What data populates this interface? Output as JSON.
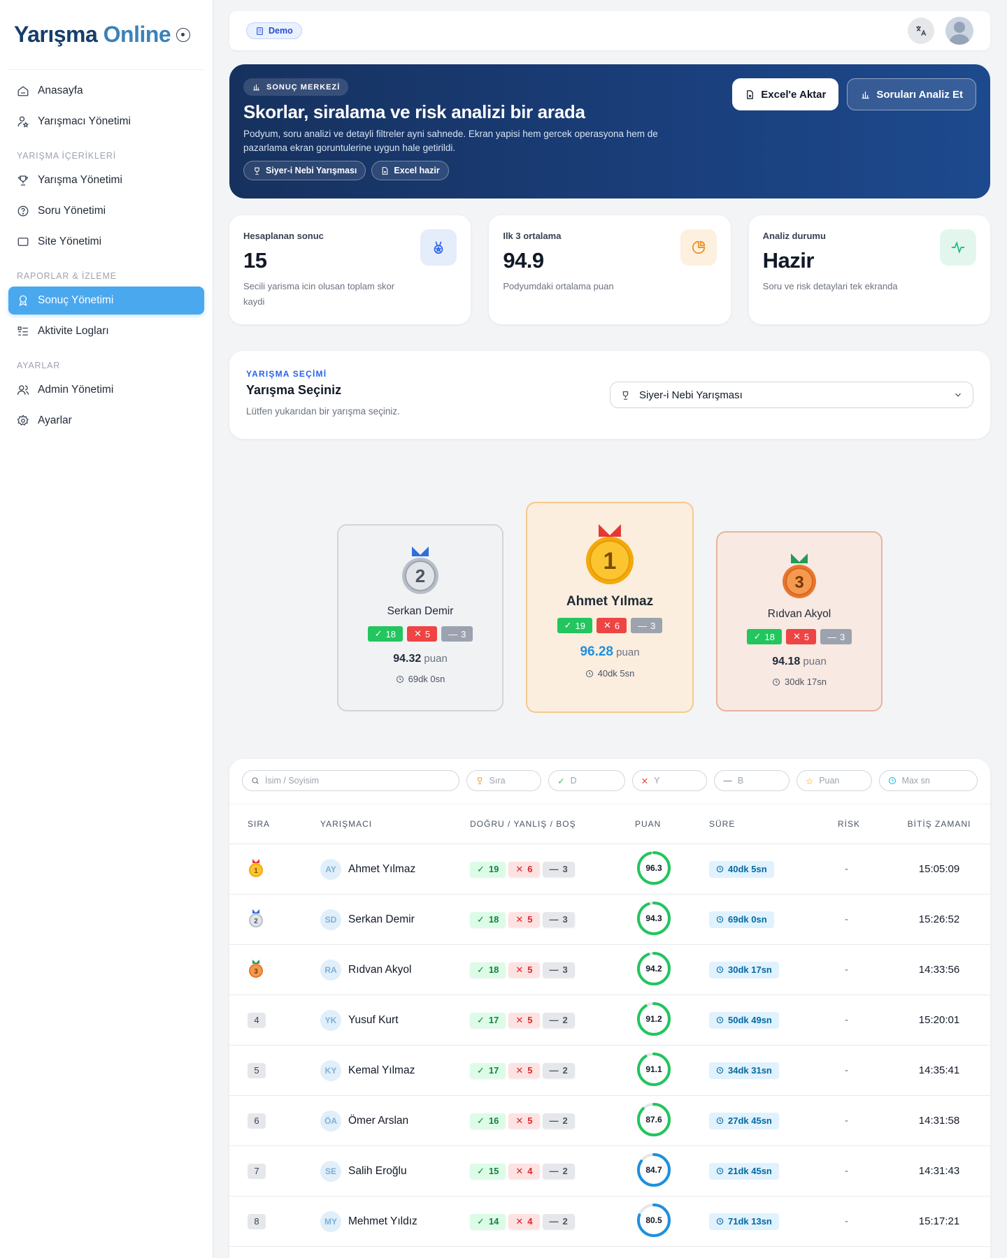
{
  "brand": {
    "part1": "Yarışma",
    "part2": "Online"
  },
  "sidebar": {
    "items_top": [
      {
        "label": "Anasayfa",
        "icon": "home-icon"
      },
      {
        "label": "Yarışmacı Yönetimi",
        "icon": "user-star-icon"
      }
    ],
    "section1": "YARIŞMA İÇERİKLERİ",
    "items_mid": [
      {
        "label": "Yarışma Yönetimi",
        "icon": "trophy-icon"
      },
      {
        "label": "Soru Yönetimi",
        "icon": "help-circle-icon"
      },
      {
        "label": "Site Yönetimi",
        "icon": "window-icon"
      }
    ],
    "section2": "RAPORLAR & İZLEME",
    "items_rep": [
      {
        "label": "Sonuç Yönetimi",
        "icon": "award-icon",
        "active": true
      },
      {
        "label": "Aktivite Logları",
        "icon": "list-icon"
      }
    ],
    "section3": "AYARLAR",
    "items_set": [
      {
        "label": "Admin Yönetimi",
        "icon": "users-icon"
      },
      {
        "label": "Ayarlar",
        "icon": "gear-icon"
      }
    ]
  },
  "topbar": {
    "badge": "Demo"
  },
  "hero": {
    "chip": "SONUÇ MERKEZİ",
    "title": "Skorlar, siralama ve risk analizi bir arada",
    "desc": "Podyum, soru analizi ve detayli filtreler ayni sahnede. Ekran yapisi hem gercek operasyona hem de pazarlama ekran goruntulerine uygun hale getirildi.",
    "tag1": "Siyer-i Nebi Yarışması",
    "tag2": "Excel hazir",
    "btn_excel": "Excel'e Aktar",
    "btn_analyze": "Soruları Analiz Et"
  },
  "stats": [
    {
      "label": "Hesaplanan sonuc",
      "value": "15",
      "sub": "Secili yarisma icin olusan toplam skor kaydi",
      "icon": "medal-icon",
      "color": "#2563eb",
      "bg": "#e5edfb"
    },
    {
      "label": "Ilk 3 ortalama",
      "value": "94.9",
      "sub": "Podyumdaki ortalama puan",
      "icon": "pie-chart-icon",
      "color": "#ea8a1a",
      "bg": "#fdf0de"
    },
    {
      "label": "Analiz durumu",
      "value": "Hazir",
      "sub": "Soru ve risk detaylari tek ekranda",
      "icon": "activity-icon",
      "color": "#10b981",
      "bg": "#e3f6ee"
    }
  ],
  "selection": {
    "kicker": "YARIŞMA SEÇİMİ",
    "title": "Yarışma Seçiniz",
    "hint": "Lütfen yukarıdan bir yarışma seçiniz.",
    "selected": "Siyer-i Nebi Yarışması"
  },
  "podium": {
    "first": {
      "rank": "1",
      "name": "Ahmet Yılmaz",
      "d": "19",
      "y": "6",
      "b": "3",
      "score": "96.28",
      "unit": "puan",
      "time": "40dk 5sn"
    },
    "second": {
      "rank": "2",
      "name": "Serkan Demir",
      "d": "18",
      "y": "5",
      "b": "3",
      "score": "94.32",
      "unit": "puan",
      "time": "69dk 0sn"
    },
    "third": {
      "rank": "3",
      "name": "Rıdvan Akyol",
      "d": "18",
      "y": "5",
      "b": "3",
      "score": "94.18",
      "unit": "puan",
      "time": "30dk 17sn"
    }
  },
  "filters": [
    {
      "placeholder": "İsim / Soyisim",
      "icon": "search-icon"
    },
    {
      "placeholder": "Sıra",
      "icon": "trophy-icon"
    },
    {
      "placeholder": "D",
      "icon": "check-icon"
    },
    {
      "placeholder": "Y",
      "icon": "x-icon"
    },
    {
      "placeholder": "B",
      "icon": "minus-icon"
    },
    {
      "placeholder": "Puan",
      "icon": "star-icon"
    },
    {
      "placeholder": "Max sn",
      "icon": "clock-icon"
    }
  ],
  "table": {
    "columns": [
      "SIRA",
      "YARIŞMACI",
      "DOĞRU / YANLIŞ / BOŞ",
      "PUAN",
      "SÜRE",
      "RİSK",
      "BİTİŞ ZAMANI"
    ],
    "rows": [
      {
        "rank": "1",
        "initials": "AY",
        "name": "Ahmet Yılmaz",
        "d": "19",
        "y": "6",
        "b": "3",
        "puan": "96.3",
        "sure": "40dk 5sn",
        "risk": "-",
        "bitis": "15:05:09"
      },
      {
        "rank": "2",
        "initials": "SD",
        "name": "Serkan Demir",
        "d": "18",
        "y": "5",
        "b": "3",
        "puan": "94.3",
        "sure": "69dk 0sn",
        "risk": "-",
        "bitis": "15:26:52"
      },
      {
        "rank": "3",
        "initials": "RA",
        "name": "Rıdvan Akyol",
        "d": "18",
        "y": "5",
        "b": "3",
        "puan": "94.2",
        "sure": "30dk 17sn",
        "risk": "-",
        "bitis": "14:33:56"
      },
      {
        "rank": "4",
        "initials": "YK",
        "name": "Yusuf Kurt",
        "d": "17",
        "y": "5",
        "b": "2",
        "puan": "91.2",
        "sure": "50dk 49sn",
        "risk": "-",
        "bitis": "15:20:01"
      },
      {
        "rank": "5",
        "initials": "KY",
        "name": "Kemal Yılmaz",
        "d": "17",
        "y": "5",
        "b": "2",
        "puan": "91.1",
        "sure": "34dk 31sn",
        "risk": "-",
        "bitis": "14:35:41"
      },
      {
        "rank": "6",
        "initials": "ÖA",
        "name": "Ömer Arslan",
        "d": "16",
        "y": "5",
        "b": "2",
        "puan": "87.6",
        "sure": "27dk 45sn",
        "risk": "-",
        "bitis": "14:31:58"
      },
      {
        "rank": "7",
        "initials": "SE",
        "name": "Salih Eroğlu",
        "d": "15",
        "y": "4",
        "b": "2",
        "puan": "84.7",
        "sure": "21dk 45sn",
        "risk": "-",
        "bitis": "14:31:43"
      },
      {
        "rank": "8",
        "initials": "MY",
        "name": "Mehmet Yıldız",
        "d": "14",
        "y": "4",
        "b": "2",
        "puan": "80.5",
        "sure": "71dk 13sn",
        "risk": "-",
        "bitis": "15:17:21"
      }
    ]
  },
  "colors": {
    "accent": "#4aa8ee",
    "green": "#22c55e",
    "blue_ring": "#1e90e0"
  }
}
